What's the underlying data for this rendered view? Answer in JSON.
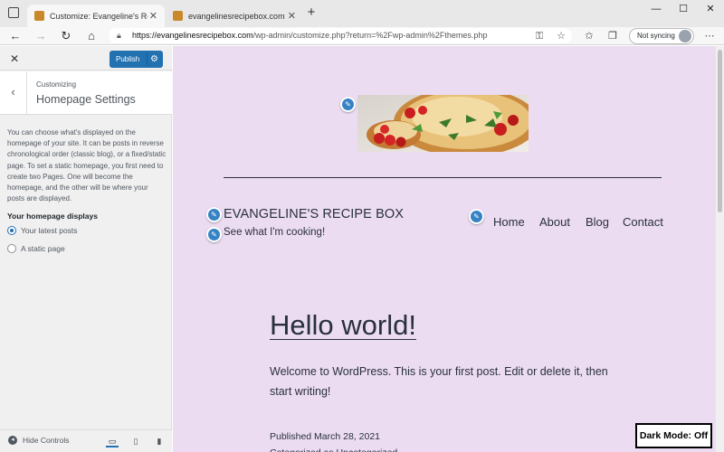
{
  "browser": {
    "tabs": [
      {
        "title": "Customize: Evangeline's Recipe B",
        "active": true
      },
      {
        "title": "evangelinesrecipebox.com – eva",
        "active": false
      }
    ],
    "new_tab": "+",
    "url_host": "https://evangelinesrecipebox.com",
    "url_path": "/wp-admin/customize.php?return=%2Fwp-admin%2Fthemes.php",
    "sync_label": "Not syncing"
  },
  "customizer": {
    "publish_label": "Publish",
    "breadcrumb": "Customizing",
    "section_title": "Homepage Settings",
    "description": "You can choose what's displayed on the homepage of your site. It can be posts in reverse chronological order (classic blog), or a fixed/static page. To set a static homepage, you first need to create two Pages. One will become the homepage, and the other will be where your posts are displayed.",
    "homepage_label": "Your homepage displays",
    "options": [
      {
        "label": "Your latest posts",
        "selected": true
      },
      {
        "label": "A static page",
        "selected": false
      }
    ],
    "hide_controls": "Hide Controls",
    "accent_color": "#2271b1"
  },
  "preview": {
    "background": "#ecdcf2",
    "site_title": "EVANGELINE'S RECIPE BOX",
    "tagline": "See what I'm cooking!",
    "menu": [
      "Home",
      "About",
      "Blog",
      "Contact"
    ],
    "post_title": "Hello world!",
    "post_body": "Welcome to WordPress. This is your first post. Edit or delete it, then start writing!",
    "published": "Published March 28, 2021",
    "categorized": "Categorized as Uncategorized",
    "dark_mode_label": "Dark Mode: Off"
  }
}
